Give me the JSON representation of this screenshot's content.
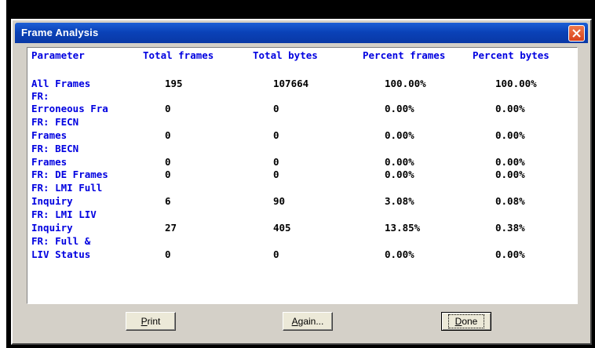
{
  "window": {
    "title": "Frame Analysis"
  },
  "table": {
    "headers": [
      "Parameter",
      "Total frames",
      "Total bytes",
      "Percent frames",
      "Percent bytes"
    ],
    "rows": [
      {
        "label": "All Frames",
        "total_frames": "195",
        "total_bytes": "107664",
        "percent_frames": "100.00%",
        "percent_bytes": "100.00%"
      },
      {
        "label": "FR:",
        "total_frames": "",
        "total_bytes": "",
        "percent_frames": "",
        "percent_bytes": ""
      },
      {
        "label": "Erroneous Fra",
        "total_frames": "0",
        "total_bytes": "0",
        "percent_frames": "0.00%",
        "percent_bytes": "0.00%"
      },
      {
        "label": "FR: FECN",
        "total_frames": "",
        "total_bytes": "",
        "percent_frames": "",
        "percent_bytes": ""
      },
      {
        "label": "Frames",
        "total_frames": "0",
        "total_bytes": "0",
        "percent_frames": "0.00%",
        "percent_bytes": "0.00%"
      },
      {
        "label": "FR: BECN",
        "total_frames": "",
        "total_bytes": "",
        "percent_frames": "",
        "percent_bytes": ""
      },
      {
        "label": "Frames",
        "total_frames": "0",
        "total_bytes": "0",
        "percent_frames": "0.00%",
        "percent_bytes": "0.00%"
      },
      {
        "label": "FR: DE Frames",
        "total_frames": "0",
        "total_bytes": "0",
        "percent_frames": "0.00%",
        "percent_bytes": "0.00%"
      },
      {
        "label": "FR: LMI Full",
        "total_frames": "",
        "total_bytes": "",
        "percent_frames": "",
        "percent_bytes": ""
      },
      {
        "label": "Inquiry",
        "total_frames": "6",
        "total_bytes": "90",
        "percent_frames": "3.08%",
        "percent_bytes": "0.08%"
      },
      {
        "label": "FR: LMI LIV",
        "total_frames": "",
        "total_bytes": "",
        "percent_frames": "",
        "percent_bytes": ""
      },
      {
        "label": "Inquiry",
        "total_frames": "27",
        "total_bytes": "405",
        "percent_frames": "13.85%",
        "percent_bytes": "0.38%"
      },
      {
        "label": "FR: Full &",
        "total_frames": "",
        "total_bytes": "",
        "percent_frames": "",
        "percent_bytes": ""
      },
      {
        "label": "LIV Status",
        "total_frames": "0",
        "total_bytes": "0",
        "percent_frames": "0.00%",
        "percent_bytes": "0.00%"
      }
    ]
  },
  "buttons": {
    "print": {
      "accel": "P",
      "rest": "rint"
    },
    "again": {
      "accel": "A",
      "rest": "gain..."
    },
    "done": {
      "accel": "D",
      "rest": "one"
    }
  },
  "colors": {
    "label_blue": "#0000e0",
    "title_blue": "#0a42b8",
    "close_red": "#d9421c"
  }
}
